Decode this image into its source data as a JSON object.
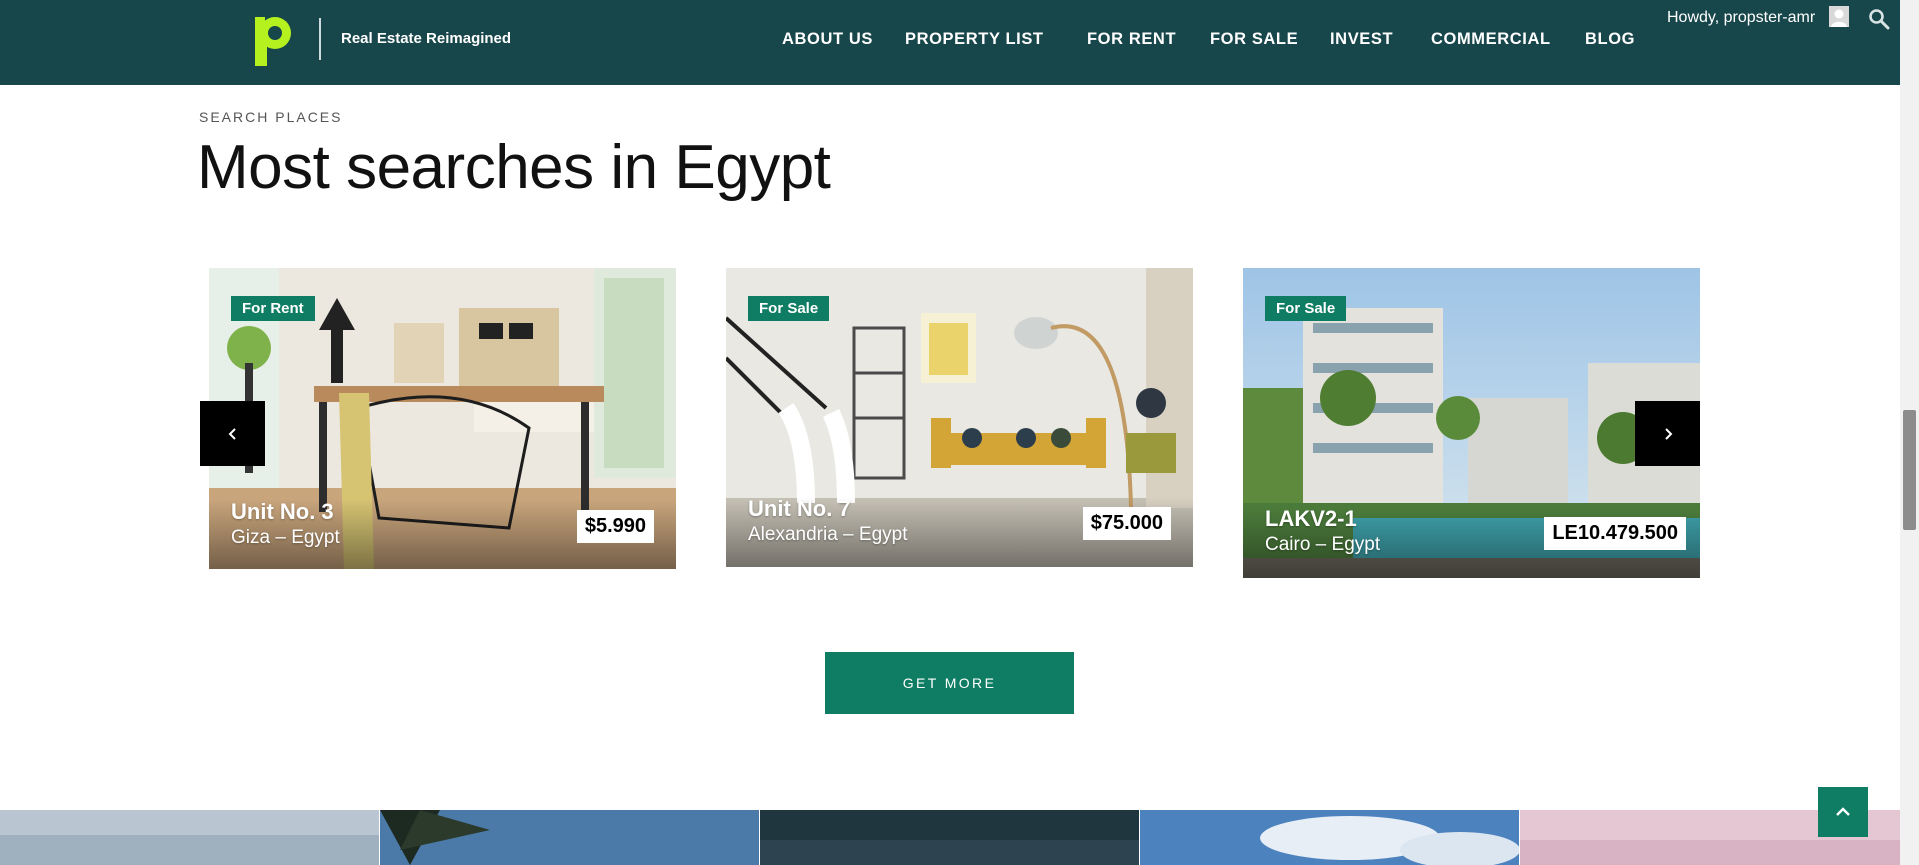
{
  "header": {
    "tagline": "Real Estate Reimagined",
    "nav": [
      "ABOUT US",
      "PROPERTY LIST",
      "FOR RENT",
      "FOR SALE",
      "INVEST",
      "COMMERCIAL",
      "BLOG"
    ],
    "user_greeting": "Howdy, propster-amr",
    "icons": {
      "logo": "brand-logo",
      "avatar": "user-avatar-icon",
      "search": "search-icon"
    },
    "colors": {
      "background": "#17464b",
      "logo_accent": "#b5f01f"
    }
  },
  "section": {
    "eyebrow": "SEARCH PLACES",
    "title": "Most searches in Egypt"
  },
  "properties": [
    {
      "status": "For Rent",
      "name": "Unit No. 3",
      "location": "Giza – Egypt",
      "price": "$5.990"
    },
    {
      "status": "For Sale",
      "name": "Unit No. 7",
      "location": "Alexandria – Egypt",
      "price": "$75.000"
    },
    {
      "status": "For Sale",
      "name": "LAKV2-1",
      "location": "Cairo – Egypt",
      "price": "LE10.479.500"
    }
  ],
  "carousel": {
    "prev_icon": "chevron-left-icon",
    "next_icon": "chevron-right-icon"
  },
  "cta": {
    "label": "GET MORE"
  },
  "back_to_top_icon": "chevron-up-icon",
  "accent_color": "#0f7d63"
}
